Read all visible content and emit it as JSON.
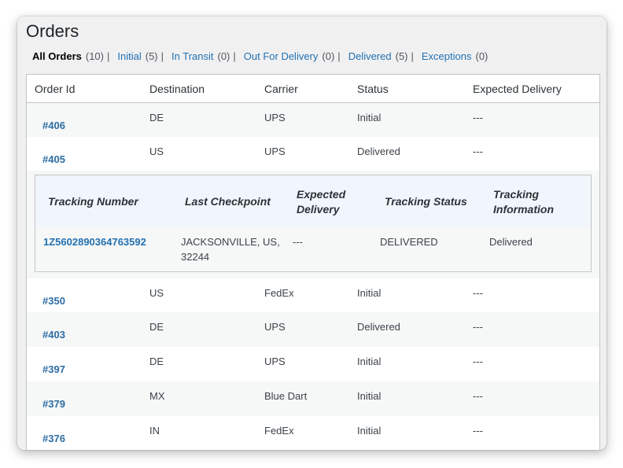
{
  "page": {
    "title": "Orders"
  },
  "filters": [
    {
      "label": "All Orders",
      "count": "(10)",
      "current": true
    },
    {
      "label": "Initial",
      "count": "(5)",
      "current": false
    },
    {
      "label": "In Transit",
      "count": "(0)",
      "current": false
    },
    {
      "label": "Out For Delivery",
      "count": "(0)",
      "current": false
    },
    {
      "label": "Delivered",
      "count": "(5)",
      "current": false
    },
    {
      "label": "Exceptions",
      "count": "(0)",
      "current": false
    }
  ],
  "filter_separator": "|",
  "table": {
    "columns": [
      "Order Id",
      "Destination",
      "Carrier",
      "Status",
      "Expected Delivery"
    ],
    "rows": [
      {
        "id": "#406",
        "destination": "DE",
        "carrier": "UPS",
        "status": "Initial",
        "expected": "---"
      },
      {
        "id": "#405",
        "destination": "US",
        "carrier": "UPS",
        "status": "Delivered",
        "expected": "---"
      },
      {
        "id": "#350",
        "destination": "US",
        "carrier": "FedEx",
        "status": "Initial",
        "expected": "---"
      },
      {
        "id": "#403",
        "destination": "DE",
        "carrier": "UPS",
        "status": "Delivered",
        "expected": "---"
      },
      {
        "id": "#397",
        "destination": "DE",
        "carrier": "UPS",
        "status": "Initial",
        "expected": "---"
      },
      {
        "id": "#379",
        "destination": "MX",
        "carrier": "Blue Dart",
        "status": "Initial",
        "expected": "---"
      },
      {
        "id": "#376",
        "destination": "IN",
        "carrier": "FedEx",
        "status": "Initial",
        "expected": "---"
      }
    ]
  },
  "tracking_detail": {
    "for_order": "#405",
    "columns": [
      "Tracking Number",
      "Last Checkpoint",
      "Expected Delivery",
      "Tracking Status",
      "Tracking Information"
    ],
    "row": {
      "tracking_number": "1Z5602890364763592",
      "last_checkpoint": "JACKSONVILLE, US, 32244",
      "expected_delivery": "---",
      "tracking_status": "DELIVERED",
      "tracking_information": "Delivered"
    }
  },
  "colors": {
    "link": "#2271b1",
    "order_link": "#2d6ca2",
    "detail_header_bg": "#f0f6fc",
    "page_bg": "#f0f0f1"
  }
}
